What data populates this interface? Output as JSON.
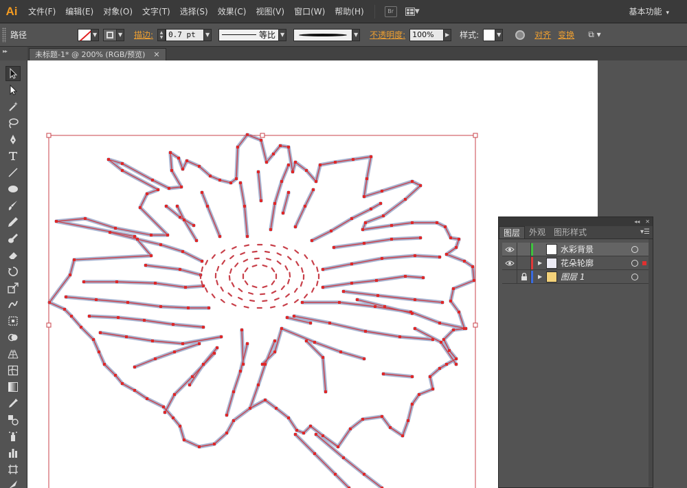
{
  "app": {
    "logo": "Ai"
  },
  "menubar": {
    "items": [
      "文件(F)",
      "编辑(E)",
      "对象(O)",
      "文字(T)",
      "选择(S)",
      "效果(C)",
      "视图(V)",
      "窗口(W)",
      "帮助(H)"
    ],
    "bridge": "Br",
    "workspace": "基本功能"
  },
  "controlbar": {
    "selection_label": "路径",
    "stroke_label": "描边:",
    "stroke_weight": "0.7 pt",
    "profile_label": "等比",
    "opacity_label": "不透明度:",
    "opacity_value": "100%",
    "style_label": "样式:",
    "align_label": "对齐",
    "transform_label": "变换"
  },
  "document": {
    "tab_title": "未标题-1* @ 200% (RGB/预览)"
  },
  "toolbox": {
    "tools": [
      "selection-tool",
      "direct-selection-tool",
      "magic-wand-tool",
      "lasso-tool",
      "pen-tool",
      "type-tool",
      "line-segment-tool",
      "ellipse-tool",
      "paintbrush-tool",
      "pencil-tool",
      "blob-brush-tool",
      "eraser-tool",
      "rotate-tool",
      "scale-tool",
      "warp-tool",
      "free-transform-tool",
      "shape-builder-tool",
      "perspective-grid-tool",
      "mesh-tool",
      "gradient-tool",
      "eyedropper-tool",
      "blend-tool",
      "symbol-sprayer-tool",
      "column-graph-tool",
      "artboard-tool",
      "slice-tool"
    ]
  },
  "layers_panel": {
    "tabs": [
      "图层",
      "外观",
      "图形样式"
    ],
    "layers": [
      {
        "name": "水彩背景",
        "visible": true,
        "locked": false,
        "color": "#3ec33e",
        "selected": true,
        "has_expand": false
      },
      {
        "name": "花朵轮廓",
        "visible": true,
        "locked": false,
        "color": "#e23a3a",
        "selected": false,
        "has_expand": true
      },
      {
        "name": "图层 1",
        "visible": false,
        "locked": true,
        "color": "#3a6be0",
        "selected": false,
        "has_expand": true
      }
    ]
  },
  "colors": {
    "path_stroke": "#c8404a",
    "path_halo": "#9aa6c8",
    "anchor": "#e02828"
  }
}
